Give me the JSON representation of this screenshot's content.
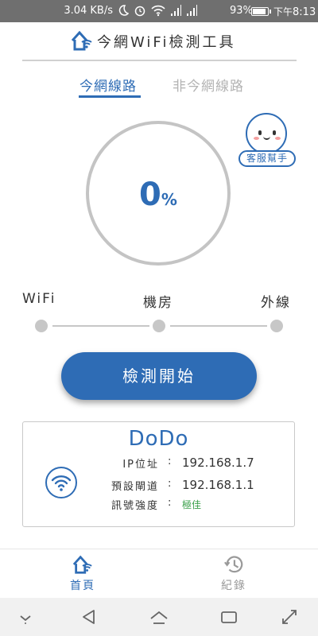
{
  "status_bar": {
    "speed": "3.04 KB/s",
    "battery": "93%",
    "battery_level": 0.93,
    "time_prefix": "下午",
    "time": "8:13"
  },
  "header": {
    "title": "今網WiFi檢測工具"
  },
  "tabs": [
    {
      "label": "今網線路",
      "active": true
    },
    {
      "label": "非今網線路",
      "active": false
    }
  ],
  "customer_service": {
    "label": "客服幫手"
  },
  "progress": {
    "value": "0",
    "unit": "%"
  },
  "stages": [
    {
      "label": "WiFi"
    },
    {
      "label": "機房"
    },
    {
      "label": "外線"
    }
  ],
  "start_button": {
    "label": "檢測開始"
  },
  "network": {
    "ssid": "DoDo",
    "rows": [
      {
        "label": "IP位址",
        "colon": ":",
        "value": "192.168.1.7"
      },
      {
        "label": "預設閘道",
        "colon": ":",
        "value": "192.168.1.1"
      },
      {
        "label": "訊號強度",
        "colon": ":",
        "value": "極佳"
      }
    ]
  },
  "bottom_nav": {
    "home": "首頁",
    "log": "紀錄"
  },
  "colors": {
    "accent": "#2e6cb5",
    "inactive": "#b3b3b3",
    "good": "#3aa04a"
  }
}
